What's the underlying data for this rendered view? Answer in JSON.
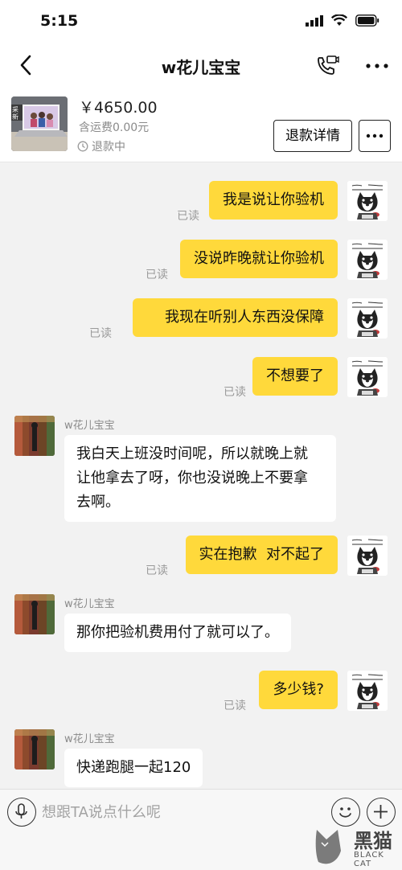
{
  "status_bar": {
    "time": "5:15",
    "icons": [
      "signal-icon",
      "wifi-icon",
      "battery-icon"
    ]
  },
  "nav": {
    "title": "w花儿宝宝",
    "back_icon": "chevron-left-icon",
    "call_icon": "phone-video-icon",
    "more_icon": "more-dots-icon"
  },
  "product": {
    "price": "￥4650.00",
    "shipping": "含运费0.00元",
    "status": "退款中",
    "status_icon": "clock-icon",
    "refund_button": "退款详情",
    "more_icon": "more-dots-icon"
  },
  "chat": {
    "messages": [
      {
        "from": "me",
        "text": "我是说让你验机",
        "read": "已读"
      },
      {
        "from": "me",
        "text": "没说昨晚就让你验机",
        "read": "已读"
      },
      {
        "from": "me",
        "text": "我现在听别人东西没保障",
        "read": "已读"
      },
      {
        "from": "me",
        "text": "不想要了",
        "read": "已读"
      },
      {
        "from": "them",
        "sender": "w花儿宝宝",
        "lines": [
          "我白天上班没时间呢，所以就晚上就",
          "让他拿去了呀，你也没说晚上不要拿",
          "去啊。"
        ]
      },
      {
        "from": "me",
        "text": "实在抱歉  对不起了",
        "read": "已读"
      },
      {
        "from": "them",
        "sender": "w花儿宝宝",
        "lines": [
          "那你把验机费用付了就可以了。"
        ]
      },
      {
        "from": "me",
        "text": "多少钱?",
        "read": "已读"
      },
      {
        "from": "them",
        "sender": "w花儿宝宝",
        "lines": [
          "快递跑腿一起120"
        ]
      }
    ]
  },
  "input": {
    "placeholder": "想跟TA说点什么呢",
    "voice_icon": "microphone-icon",
    "emoji_icon": "smiley-icon",
    "plus_icon": "plus-icon"
  },
  "watermark": {
    "text": "黑猫",
    "sub": "BLACK CAT"
  },
  "colors": {
    "my_bubble": "#ffd93b",
    "their_bubble": "#ffffff",
    "background": "#f2f2f2"
  }
}
